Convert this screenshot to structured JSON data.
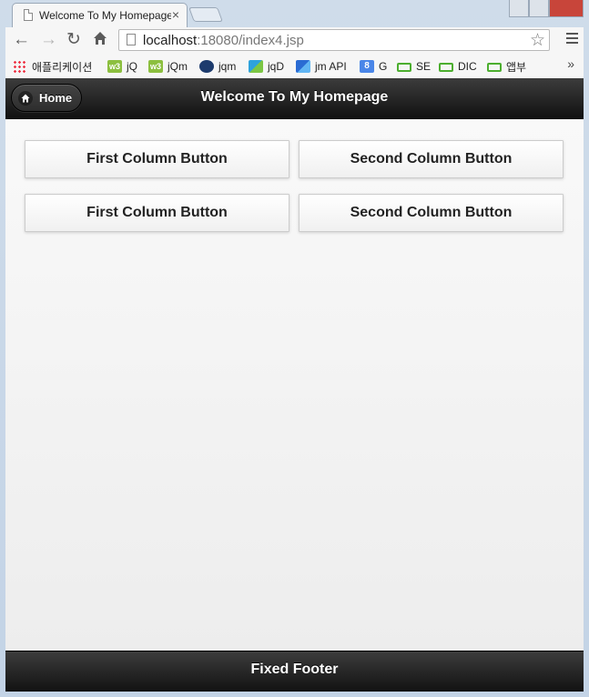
{
  "browser": {
    "tab_title": "Welcome To My Homepage",
    "tab_close": "×",
    "url_host": "localhost",
    "url_rest": ":18080/index4.jsp",
    "bookmarks": [
      "애플리케이션",
      "jQ",
      "jQm",
      "jqm",
      "jqD",
      "jm API",
      "G",
      "SE",
      "DIC",
      "앱부"
    ],
    "bookmarks_more": "»"
  },
  "header": {
    "home_label": "Home",
    "title": "Welcome To My Homepage"
  },
  "grid": {
    "row1": {
      "col1": "First Column Button",
      "col2": "Second Column Button"
    },
    "row2": {
      "col1": "First Column Button",
      "col2": "Second Column Button"
    }
  },
  "footer": {
    "title": "Fixed Footer"
  },
  "colors": {
    "bar_dark": "#1e1e1e",
    "content_bg": "#f6f6f6"
  }
}
